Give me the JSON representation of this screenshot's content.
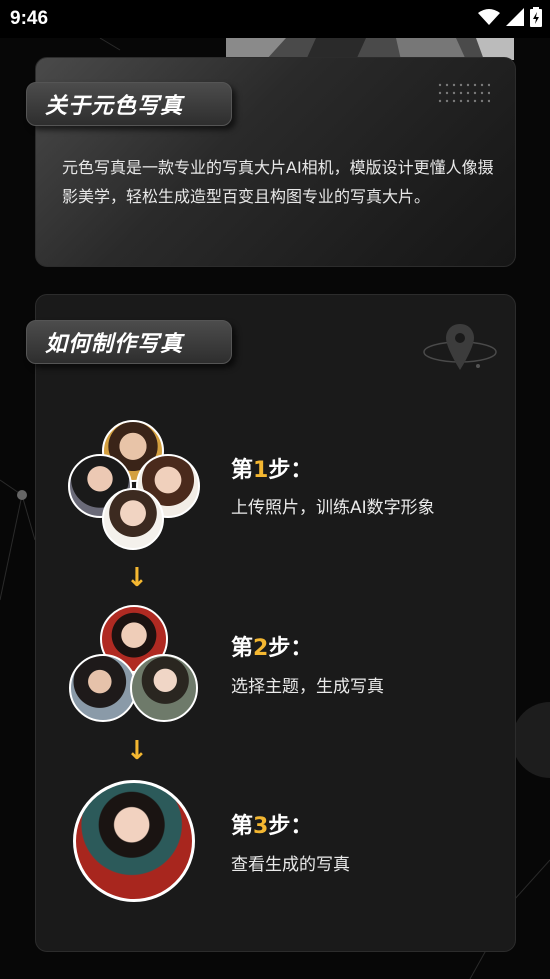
{
  "status_bar": {
    "time": "9:46"
  },
  "about": {
    "title": "关于元色写真",
    "text": "元色写真是一款专业的写真大片AI相机，模版设计更懂人像摄影美学，轻松生成造型百变且构图专业的写真大片。"
  },
  "how": {
    "title": "如何制作写真",
    "steps": [
      {
        "prefix": "第",
        "num": "1",
        "suffix": "步：",
        "desc": "上传照片，训练AI数字形象"
      },
      {
        "prefix": "第",
        "num": "2",
        "suffix": "步：",
        "desc": "选择主题，生成写真"
      },
      {
        "prefix": "第",
        "num": "3",
        "suffix": "步：",
        "desc": "查看生成的写真"
      }
    ],
    "arrow": "↓"
  },
  "colors": {
    "accent": "#f4b731",
    "background": "#070707",
    "card": "#1a1a1a"
  },
  "icons": [
    "wifi-icon",
    "signal-icon",
    "battery-icon",
    "location-pin-icon",
    "dot-grid-icon",
    "arrow-down-icon"
  ]
}
